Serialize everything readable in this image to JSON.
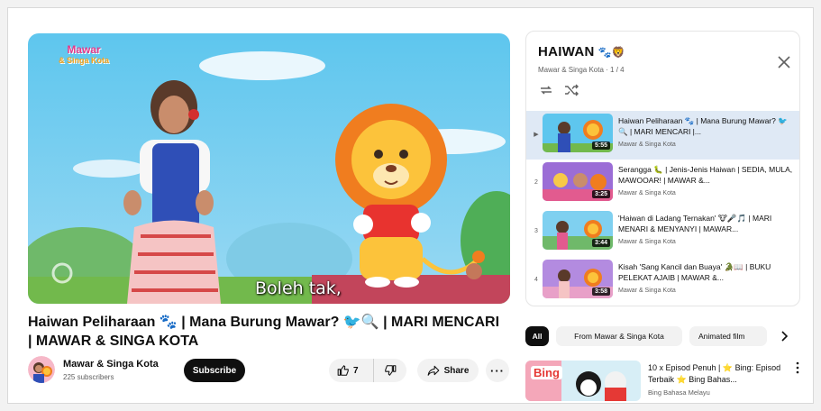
{
  "player": {
    "logo_line1": "Mawar",
    "logo_line2": "& Singa Kota",
    "subtitle": "Boleh tak,"
  },
  "video": {
    "title": "Haiwan Peliharaan 🐾 | Mana Burung Mawar? 🐦🔍 | MARI MENCARI | MAWAR & SINGA KOTA"
  },
  "channel": {
    "name": "Mawar & Singa Kota",
    "subscribers": "225 subscribers",
    "subscribe_label": "Subscribe"
  },
  "actions": {
    "like_count": "7",
    "share_label": "Share",
    "more_label": "···"
  },
  "playlist": {
    "title": "HAIWAN",
    "title_emoji": "🐾🦁",
    "subtitle": "Mawar & Singa Kota · 1 / 4",
    "items": [
      {
        "index": "▶",
        "title": "Haiwan Peliharaan 🐾 | Mana Burung Mawar? 🐦🔍 | MARI MENCARI |...",
        "channel": "Mawar & Singa Kota",
        "duration": "5:55"
      },
      {
        "index": "2",
        "title": "Serangga 🐛 | Jenis-Jenis Haiwan | SEDIA, MULA, MAWOOAR! | MAWAR &...",
        "channel": "Mawar & Singa Kota",
        "duration": "3:25"
      },
      {
        "index": "3",
        "title": "'Haiwan di Ladang Ternakan' 🐮🎤🎵 | MARI MENARI & MENYANYI | MAWAR...",
        "channel": "Mawar & Singa Kota",
        "duration": "3:44"
      },
      {
        "index": "4",
        "title": "Kisah 'Sang Kancil dan Buaya' 🐊📖 | BUKU PELEKAT AJAIB | MAWAR &...",
        "channel": "Mawar & Singa Kota",
        "duration": "3:58"
      }
    ]
  },
  "chips": {
    "all": "All",
    "from_channel": "From Mawar & Singa Kota",
    "animated": "Animated film"
  },
  "recommendation": {
    "thumb_text": "Bing",
    "title": "10 x Episod Penuh | ⭐ Bing: Episod Terbaik ⭐ Bing Bahas...",
    "channel": "Bing Bahasa Melayu"
  },
  "colors": {
    "accent": "#0f0f0f",
    "active_row": "#dfe9f5",
    "chip_bg": "#f2f2f2"
  }
}
